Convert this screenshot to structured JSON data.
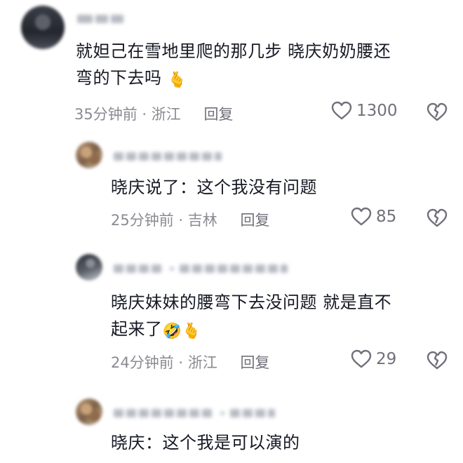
{
  "comments": [
    {
      "text_line1": "就妲己在雪地里爬的那几步 晓庆奶奶腰还",
      "text_line2": "弯的下去吗",
      "emoji": "🫰",
      "time": "35分钟前 · 浙江",
      "reply_label": "回复",
      "likes": "1300"
    },
    {
      "text_line1": "晓庆说了：这个我没有问题",
      "time": "25分钟前 · 吉林",
      "reply_label": "回复",
      "likes": "85"
    },
    {
      "text_line1": "晓庆妹妹的腰弯下去没问题 就是直不",
      "text_line2": "起来了",
      "emoji1": "🤣",
      "emoji2": "🫰",
      "time": "24分钟前 · 浙江",
      "reply_label": "回复",
      "likes": "29"
    },
    {
      "text_line1": "晓庆：这个我是可以演的"
    }
  ],
  "icons": {
    "like": "heart-outline-icon",
    "dislike": "broken-heart-icon"
  },
  "colors": {
    "text": "#161823",
    "meta": "#8a8b91",
    "icon": "#70717a"
  }
}
